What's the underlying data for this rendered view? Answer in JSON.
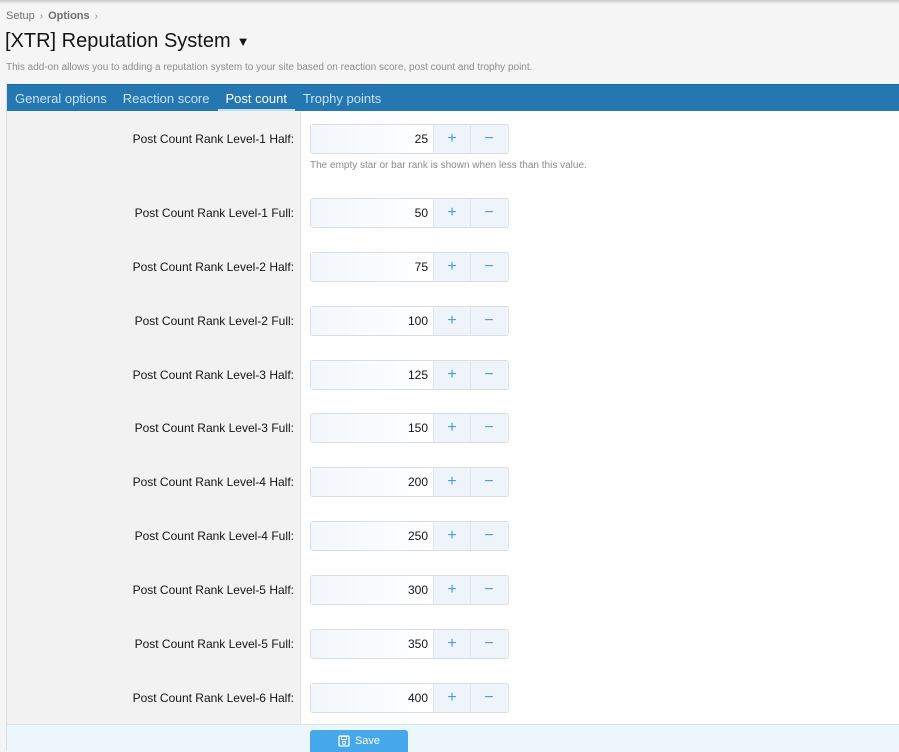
{
  "breadcrumb": [
    {
      "label": "Setup"
    },
    {
      "label": "Options"
    }
  ],
  "page": {
    "title": "[XTR] Reputation System",
    "description": "This add-on allows you to adding a reputation system to your site based on reaction score, post count and trophy point."
  },
  "tabs": [
    {
      "label": "General options",
      "active": false
    },
    {
      "label": "Reaction score",
      "active": false
    },
    {
      "label": "Post count",
      "active": true
    },
    {
      "label": "Trophy points",
      "active": false
    }
  ],
  "fields": [
    {
      "label": "Post Count Rank Level-1 Half:",
      "value": "25",
      "hint": "The empty star or bar rank is shown when less than this value."
    },
    {
      "label": "Post Count Rank Level-1 Full:",
      "value": "50"
    },
    {
      "label": "Post Count Rank Level-2 Half:",
      "value": "75"
    },
    {
      "label": "Post Count Rank Level-2 Full:",
      "value": "100"
    },
    {
      "label": "Post Count Rank Level-3 Half:",
      "value": "125"
    },
    {
      "label": "Post Count Rank Level-3 Full:",
      "value": "150"
    },
    {
      "label": "Post Count Rank Level-4 Half:",
      "value": "200"
    },
    {
      "label": "Post Count Rank Level-4 Full:",
      "value": "250"
    },
    {
      "label": "Post Count Rank Level-5 Half:",
      "value": "300"
    },
    {
      "label": "Post Count Rank Level-5 Full:",
      "value": "350"
    },
    {
      "label": "Post Count Rank Level-6 Half:",
      "value": "400"
    }
  ],
  "stepper": {
    "increment": "+",
    "decrement": "−"
  },
  "icons": {
    "breadcrumb_separator": "›",
    "title_dropdown": "▼",
    "save": "save-icon"
  },
  "footer": {
    "save_label": "Save"
  },
  "colors": {
    "tab_bar": "#2577b1",
    "save_button": "#47a7eb",
    "stepper_glyph": "#4a9be0"
  }
}
